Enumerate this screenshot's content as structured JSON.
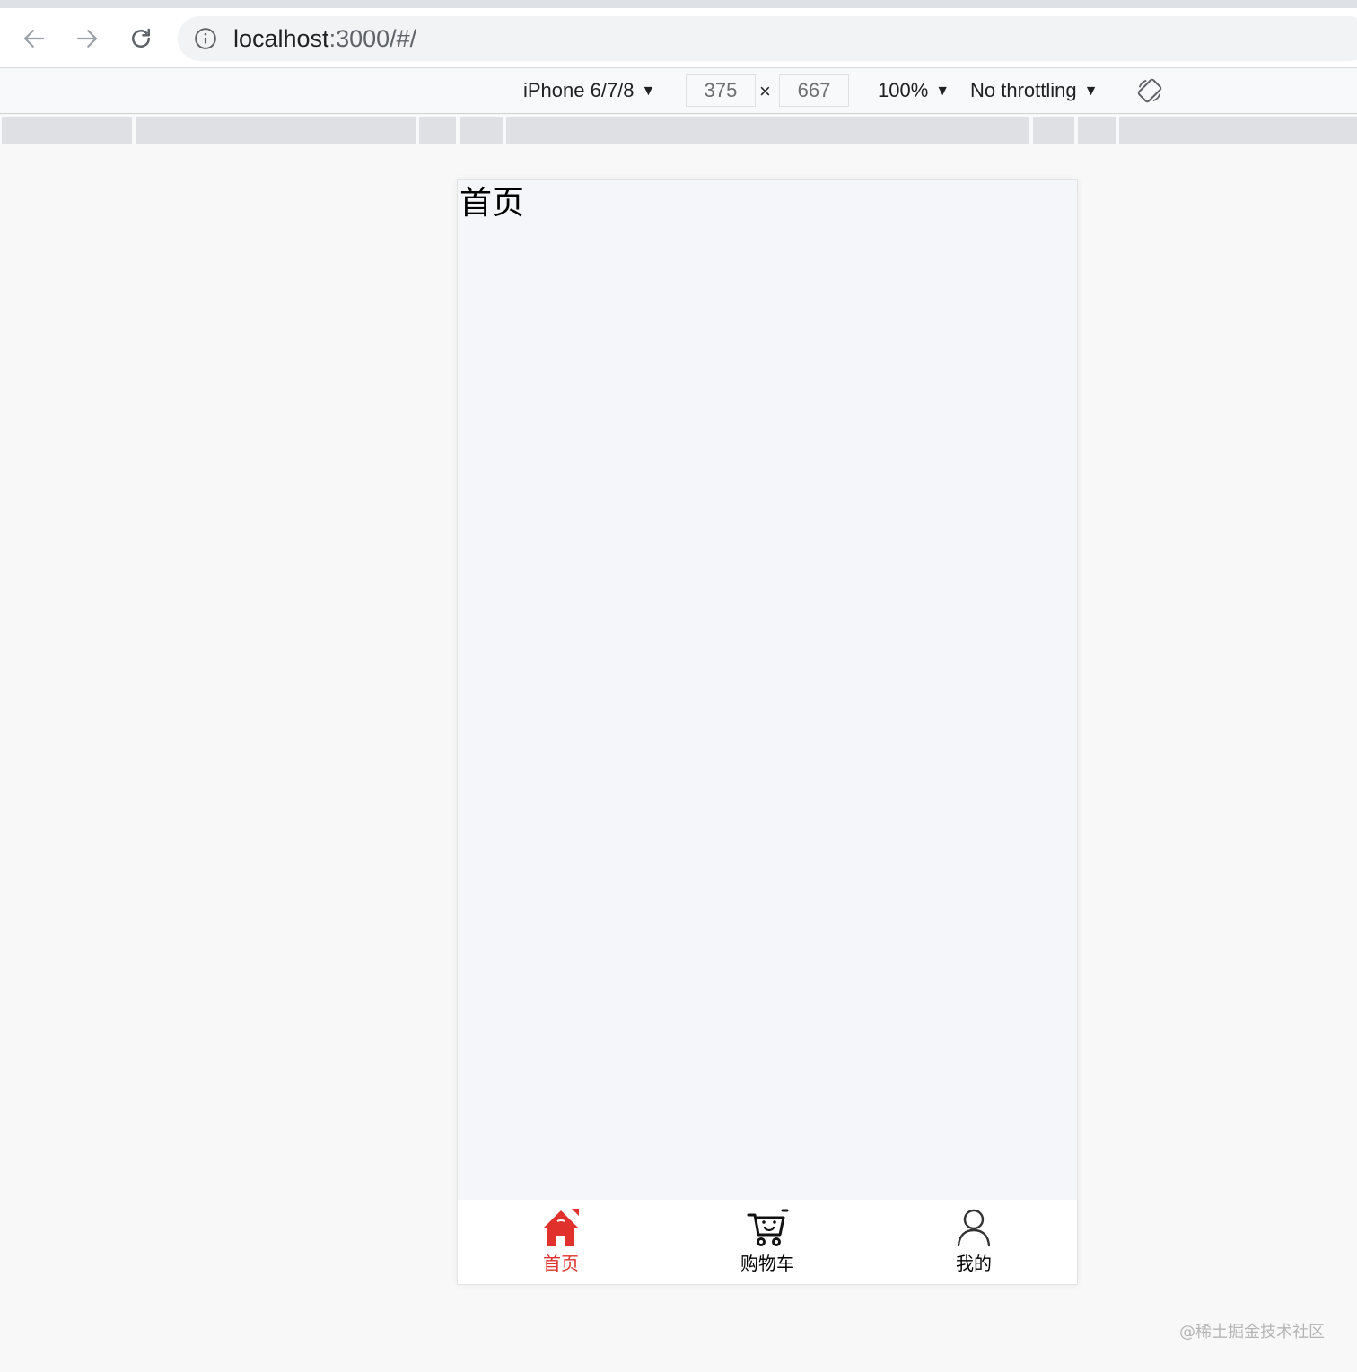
{
  "browser": {
    "url_host": "localhost",
    "url_rest": ":3000/#/"
  },
  "device_toolbar": {
    "device": "iPhone 6/7/8",
    "width": "375",
    "times": "×",
    "height": "667",
    "zoom": "100%",
    "throttling": "No throttling"
  },
  "app": {
    "page_title": "首页",
    "tabs": [
      {
        "label": "首页",
        "icon": "home-icon",
        "active": true
      },
      {
        "label": "购物车",
        "icon": "cart-icon",
        "active": false
      },
      {
        "label": "我的",
        "icon": "user-icon",
        "active": false
      }
    ],
    "active_color": "#e0312d"
  },
  "watermark": "@稀土掘金技术社区"
}
